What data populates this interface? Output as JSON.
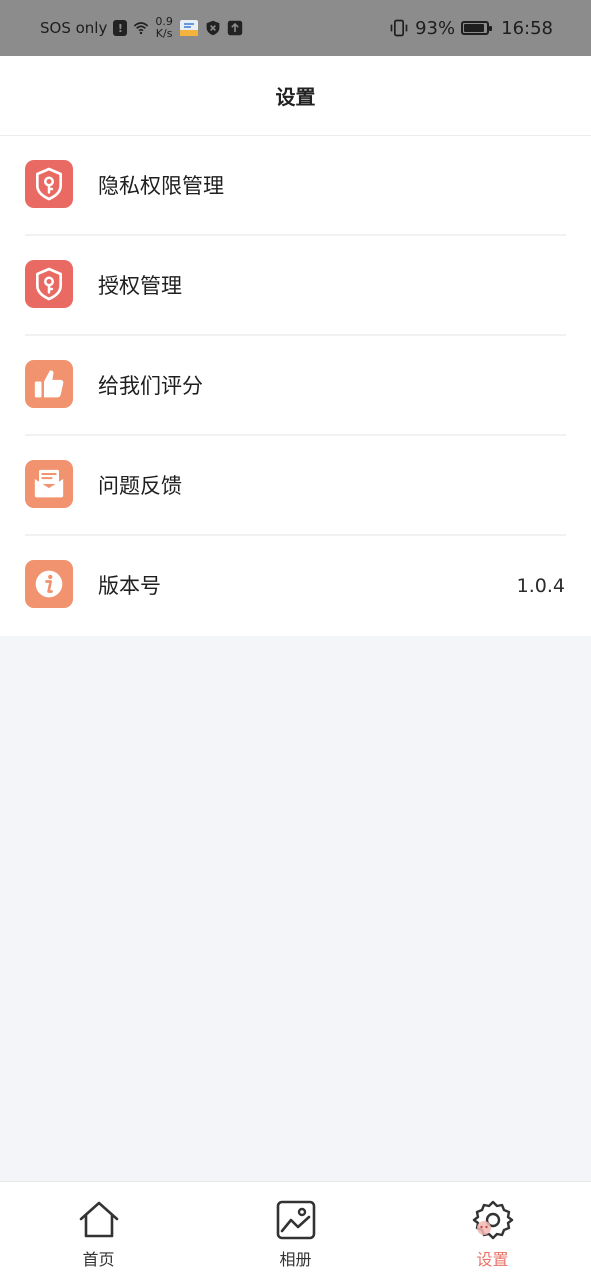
{
  "status_bar": {
    "carrier": "SOS only",
    "net_speed_value": "0.9",
    "net_speed_unit": "K/s",
    "battery_percent": "93%",
    "battery_level": 0.93,
    "time": "16:58"
  },
  "header": {
    "title": "设置"
  },
  "settings": {
    "items": [
      {
        "label": "隐私权限管理",
        "icon": "shield-key-icon",
        "color": "#e96a63"
      },
      {
        "label": "授权管理",
        "icon": "shield-key-icon",
        "color": "#e96a63"
      },
      {
        "label": "给我们评分",
        "icon": "thumbs-up-icon",
        "color": "#f0936e"
      },
      {
        "label": "问题反馈",
        "icon": "mail-icon",
        "color": "#f0936e"
      },
      {
        "label": "版本号",
        "icon": "info-icon",
        "color": "#f0936e",
        "value": "1.0.4"
      }
    ]
  },
  "bottom_nav": {
    "items": [
      {
        "label": "首页",
        "icon": "home-icon",
        "active": false
      },
      {
        "label": "相册",
        "icon": "photo-album-icon",
        "active": false
      },
      {
        "label": "设置",
        "icon": "gear-icon",
        "active": true
      }
    ],
    "active_color": "#e8746a"
  }
}
